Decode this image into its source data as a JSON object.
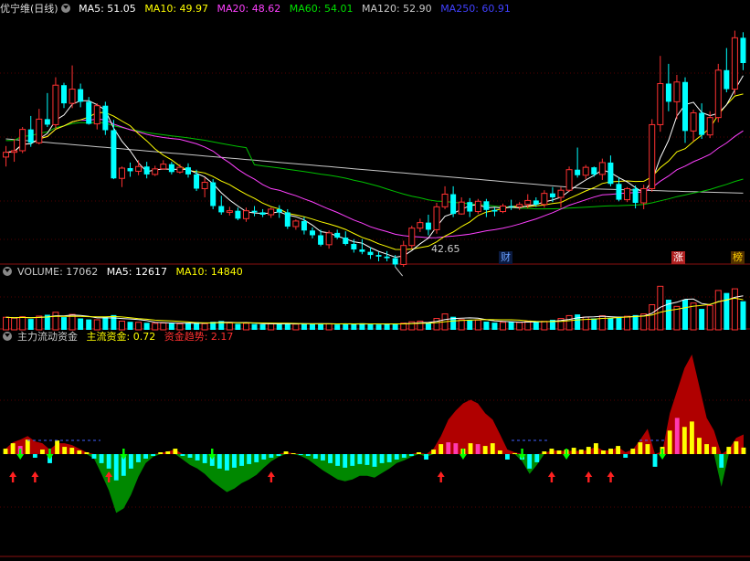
{
  "price_panel": {
    "title": "优宁维(日线)",
    "ma_legend": [
      {
        "label": "MA5: 51.05",
        "color": "#ffffff"
      },
      {
        "label": "MA10: 49.97",
        "color": "#ffff00"
      },
      {
        "label": "MA20: 48.62",
        "color": "#ff40ff"
      },
      {
        "label": "MA60: 54.01",
        "color": "#00e000"
      },
      {
        "label": "MA120: 52.90",
        "color": "#c8c8c8"
      },
      {
        "label": "MA250: 60.91",
        "color": "#4040ff"
      }
    ],
    "low_label": "42.65",
    "markers": [
      {
        "text": "财",
        "color": "#6aa0ff",
        "bg": "#0a1a40"
      },
      {
        "text": "涨",
        "color": "#ffffff",
        "bg": "#b02020"
      },
      {
        "text": "榜",
        "color": "#ffd000",
        "bg": "#503000"
      }
    ]
  },
  "volume_panel": {
    "legend": [
      {
        "label": "VOLUME: 17062",
        "color": "#cccccc"
      },
      {
        "label": "MA5: 12617",
        "color": "#ffffff"
      },
      {
        "label": "MA10: 14840",
        "color": "#ffff00"
      }
    ]
  },
  "fund_panel": {
    "legend": [
      {
        "label": "主力流动资金",
        "color": "#cccccc"
      },
      {
        "label": "主流资金: 0.72",
        "color": "#ffff00"
      },
      {
        "label": "资金趋势: 2.17",
        "color": "#ff3030"
      }
    ]
  },
  "chart_data": [
    {
      "type": "candlestick",
      "title": "优宁维(日线)",
      "ylim": [
        41,
        72
      ],
      "low_annotation": 42.65,
      "colors": {
        "up": "#ff3232",
        "down": "#00ffff"
      },
      "candles": [
        [
          54.2,
          55.6,
          53.0,
          54.8
        ],
        [
          54.8,
          56.5,
          53.6,
          55.0
        ],
        [
          55.0,
          58.0,
          54.7,
          57.7
        ],
        [
          57.7,
          59.4,
          55.5,
          56.0
        ],
        [
          56.0,
          60.3,
          55.8,
          59.0
        ],
        [
          59.0,
          62.3,
          58.0,
          58.3
        ],
        [
          58.3,
          64.3,
          57.8,
          63.3
        ],
        [
          63.3,
          63.6,
          60.4,
          61.0
        ],
        [
          61.0,
          65.8,
          60.4,
          62.8
        ],
        [
          62.8,
          63.5,
          60.5,
          61.2
        ],
        [
          61.2,
          61.8,
          58.3,
          58.4
        ],
        [
          58.4,
          61.0,
          57.7,
          60.7
        ],
        [
          60.7,
          61.2,
          57.0,
          57.6
        ],
        [
          57.6,
          58.9,
          51.4,
          51.5
        ],
        [
          51.5,
          53.0,
          50.4,
          52.8
        ],
        [
          52.8,
          53.5,
          51.7,
          52.4
        ],
        [
          52.4,
          53.8,
          51.9,
          53.0
        ],
        [
          53.0,
          53.6,
          51.5,
          52.0
        ],
        [
          52.0,
          53.1,
          51.8,
          52.7
        ],
        [
          52.7,
          53.8,
          52.6,
          53.3
        ],
        [
          53.3,
          53.6,
          52.0,
          52.3
        ],
        [
          52.3,
          53.3,
          52.1,
          52.9
        ],
        [
          52.9,
          53.4,
          51.6,
          52.0
        ],
        [
          52.0,
          52.6,
          49.9,
          50.2
        ],
        [
          50.2,
          51.6,
          49.1,
          51.0
        ],
        [
          51.0,
          51.4,
          47.6,
          48.0
        ],
        [
          48.0,
          49.3,
          46.9,
          47.2
        ],
        [
          47.2,
          47.9,
          46.8,
          47.4
        ],
        [
          47.4,
          47.8,
          46.2,
          46.4
        ],
        [
          46.4,
          47.8,
          46.0,
          47.4
        ],
        [
          47.4,
          48.0,
          46.7,
          47.2
        ],
        [
          47.2,
          47.6,
          46.6,
          46.9
        ],
        [
          46.9,
          47.8,
          46.5,
          47.6
        ],
        [
          47.6,
          48.1,
          46.5,
          47.2
        ],
        [
          47.2,
          47.6,
          45.1,
          45.4
        ],
        [
          45.4,
          46.3,
          45.0,
          46.1
        ],
        [
          46.1,
          46.6,
          44.4,
          44.9
        ],
        [
          44.9,
          45.3,
          43.9,
          44.3
        ],
        [
          44.3,
          45.0,
          42.9,
          43.1
        ],
        [
          43.1,
          44.9,
          42.6,
          44.6
        ],
        [
          44.6,
          45.0,
          43.8,
          44.0
        ],
        [
          44.0,
          44.8,
          43.0,
          43.2
        ],
        [
          43.2,
          43.8,
          42.1,
          42.5
        ],
        [
          42.5,
          43.8,
          41.9,
          42.2
        ],
        [
          42.2,
          42.8,
          41.3,
          41.8
        ],
        [
          41.8,
          42.2,
          41.0,
          41.6
        ],
        [
          41.6,
          42.3,
          41.0,
          41.4
        ],
        [
          41.4,
          41.8,
          40.3,
          40.6
        ],
        [
          40.6,
          43.6,
          40.3,
          43.0
        ],
        [
          43.0,
          45.5,
          42.6,
          45.2
        ],
        [
          45.2,
          46.4,
          44.7,
          45.9
        ],
        [
          45.9,
          46.9,
          44.3,
          45.0
        ],
        [
          45.0,
          48.4,
          44.5,
          47.9
        ],
        [
          47.9,
          50.5,
          47.6,
          49.5
        ],
        [
          49.5,
          50.5,
          46.6,
          47.0
        ],
        [
          47.0,
          49.1,
          46.9,
          48.5
        ],
        [
          48.5,
          49.0,
          46.6,
          47.3
        ],
        [
          47.3,
          48.9,
          47.0,
          48.6
        ],
        [
          48.6,
          48.9,
          46.6,
          47.5
        ],
        [
          47.5,
          47.8,
          46.7,
          47.3
        ],
        [
          47.3,
          48.3,
          47.1,
          48.0
        ],
        [
          48.0,
          48.8,
          47.5,
          47.9
        ],
        [
          47.9,
          48.5,
          47.5,
          48.2
        ],
        [
          48.2,
          49.5,
          47.7,
          48.7
        ],
        [
          48.7,
          49.1,
          47.9,
          48.2
        ],
        [
          48.2,
          50.0,
          47.8,
          49.6
        ],
        [
          49.6,
          50.4,
          48.5,
          49.1
        ],
        [
          49.1,
          50.4,
          47.8,
          50.0
        ],
        [
          50.0,
          53.0,
          49.8,
          52.6
        ],
        [
          52.6,
          55.4,
          51.6,
          51.9
        ],
        [
          51.9,
          53.2,
          51.4,
          52.9
        ],
        [
          52.9,
          53.0,
          51.7,
          52.0
        ],
        [
          52.0,
          54.0,
          51.3,
          53.5
        ],
        [
          53.5,
          54.4,
          50.5,
          50.8
        ],
        [
          50.8,
          51.6,
          48.6,
          48.8
        ],
        [
          48.8,
          50.4,
          48.5,
          50.2
        ],
        [
          50.2,
          50.6,
          47.7,
          48.4
        ],
        [
          48.4,
          50.7,
          47.6,
          50.2
        ],
        [
          50.2,
          59.0,
          49.8,
          58.3
        ],
        [
          58.3,
          67.0,
          57.4,
          63.5
        ],
        [
          63.5,
          66.0,
          60.0,
          61.2
        ],
        [
          61.2,
          64.6,
          59.0,
          63.7
        ],
        [
          63.7,
          64.3,
          56.0,
          57.5
        ],
        [
          57.5,
          60.2,
          56.2,
          59.8
        ],
        [
          59.8,
          61.0,
          56.5,
          57.0
        ],
        [
          57.0,
          60.0,
          56.6,
          59.2
        ],
        [
          59.2,
          66.0,
          58.6,
          65.2
        ],
        [
          65.2,
          68.0,
          62.4,
          62.8
        ],
        [
          62.8,
          70.2,
          62.1,
          69.3
        ],
        [
          69.3,
          70.0,
          65.2,
          66.1
        ]
      ]
    },
    {
      "type": "bar",
      "title": "VOLUME",
      "ylim": [
        0,
        30000
      ],
      "colors": {
        "up": "#ff3232",
        "down": "#00ffff",
        "ma5": "#ffffff",
        "ma10": "#ffff00"
      },
      "values": [
        7500,
        7000,
        7800,
        6500,
        8200,
        9000,
        10500,
        7600,
        9200,
        6800,
        6200,
        6000,
        7600,
        8800,
        5200,
        4800,
        4500,
        4200,
        3900,
        4100,
        3800,
        3600,
        4200,
        4600,
        3700,
        4800,
        5300,
        4100,
        3600,
        3900,
        3500,
        3300,
        3600,
        3500,
        4000,
        3400,
        3700,
        3500,
        3800,
        3600,
        3200,
        3500,
        3300,
        3900,
        3700,
        3200,
        3400,
        3600,
        4000,
        4800,
        5200,
        4600,
        6800,
        9500,
        7800,
        6100,
        5600,
        5800,
        4900,
        4300,
        4500,
        4800,
        4400,
        5200,
        4700,
        5100,
        6000,
        6800,
        8500,
        9200,
        7600,
        6800,
        8400,
        7200,
        7900,
        8100,
        8800,
        9500,
        15000,
        26000,
        18000,
        14000,
        18000,
        16000,
        12500,
        14500,
        23500,
        22000,
        24500,
        17062
      ]
    },
    {
      "type": "bar",
      "title": "主力流动资金",
      "ylim": [
        -8,
        11
      ],
      "colors": {
        "pos_area": "#b00000",
        "neg_area": "#008800",
        "pos_bar": "#ffff00",
        "strong_bar": "#ff3ab0",
        "neg_bar": "#00ffff",
        "up_arrow": "#ff2020",
        "down_arrow": "#00ff00"
      },
      "values": [
        0.6,
        1.2,
        0.9,
        1.6,
        -0.4,
        0.5,
        -1.0,
        1.5,
        0.8,
        0.7,
        0.4,
        0.2,
        -0.5,
        -1.0,
        -1.6,
        -2.9,
        -2.4,
        -1.6,
        -0.9,
        -0.5,
        -0.2,
        0.2,
        0.3,
        0.6,
        -0.2,
        -0.4,
        -0.7,
        -1.0,
        -1.3,
        -1.6,
        -1.8,
        -1.5,
        -1.3,
        -1.1,
        -0.9,
        -0.6,
        -0.4,
        -0.2,
        0.3,
        0.1,
        -0.1,
        -0.2,
        -0.5,
        -0.7,
        -1.0,
        -1.3,
        -1.5,
        -1.3,
        -1.1,
        -1.2,
        -1.4,
        -1.0,
        -0.9,
        -0.6,
        -0.4,
        -0.2,
        0.2,
        -0.6,
        0.5,
        1.1,
        1.3,
        1.2,
        0.6,
        1.2,
        1.1,
        0.9,
        1.2,
        0.4,
        -0.6,
        0.1,
        -0.6,
        -1.6,
        -0.9,
        0.3,
        0.6,
        0.4,
        0.5,
        0.7,
        0.5,
        0.8,
        1.2,
        0.4,
        0.6,
        0.9,
        -0.4,
        0.6,
        1.3,
        1.1,
        -1.4,
        0.8,
        2.6,
        4.0,
        3.0,
        3.6,
        1.8,
        1.1,
        0.8,
        -1.5,
        0.8,
        1.4,
        0.72
      ],
      "trend": [
        0.6,
        1.3,
        1.6,
        2.0,
        1.4,
        1.2,
        0.5,
        1.2,
        1.2,
        1.0,
        0.6,
        0.2,
        -0.5,
        -2.2,
        -4.0,
        -6.5,
        -6.0,
        -4.5,
        -2.5,
        -1.0,
        -0.3,
        0.1,
        0.3,
        0.5,
        -0.6,
        -1.2,
        -1.6,
        -2.2,
        -3.0,
        -3.6,
        -4.2,
        -3.8,
        -3.2,
        -2.8,
        -2.3,
        -1.5,
        -0.8,
        -0.3,
        0.2,
        0.1,
        -0.2,
        -0.6,
        -1.2,
        -1.8,
        -2.3,
        -2.8,
        -3.0,
        -2.8,
        -2.4,
        -2.4,
        -2.6,
        -2.1,
        -1.6,
        -1.0,
        -0.7,
        -0.3,
        0.2,
        -0.3,
        0.6,
        2.0,
        3.8,
        4.8,
        5.6,
        6.0,
        5.6,
        4.5,
        3.8,
        2.2,
        0.5,
        0.2,
        -0.8,
        -2.2,
        -1.2,
        0.1,
        0.4,
        0.4,
        0.3,
        0.4,
        0.3,
        0.5,
        0.8,
        0.4,
        0.4,
        0.8,
        0.2,
        0.5,
        1.6,
        2.8,
        0.0,
        0.3,
        4.5,
        7.0,
        9.5,
        11.0,
        7.5,
        4.0,
        2.6,
        -3.6,
        0.5,
        1.8,
        2.17
      ],
      "strong_days": [
        2,
        60,
        61,
        64,
        91
      ],
      "up_arrows": [
        1,
        4,
        14,
        36,
        59,
        74,
        79,
        82
      ],
      "down_arrows": [
        2,
        6,
        16,
        28,
        62,
        70,
        76,
        89
      ]
    }
  ]
}
